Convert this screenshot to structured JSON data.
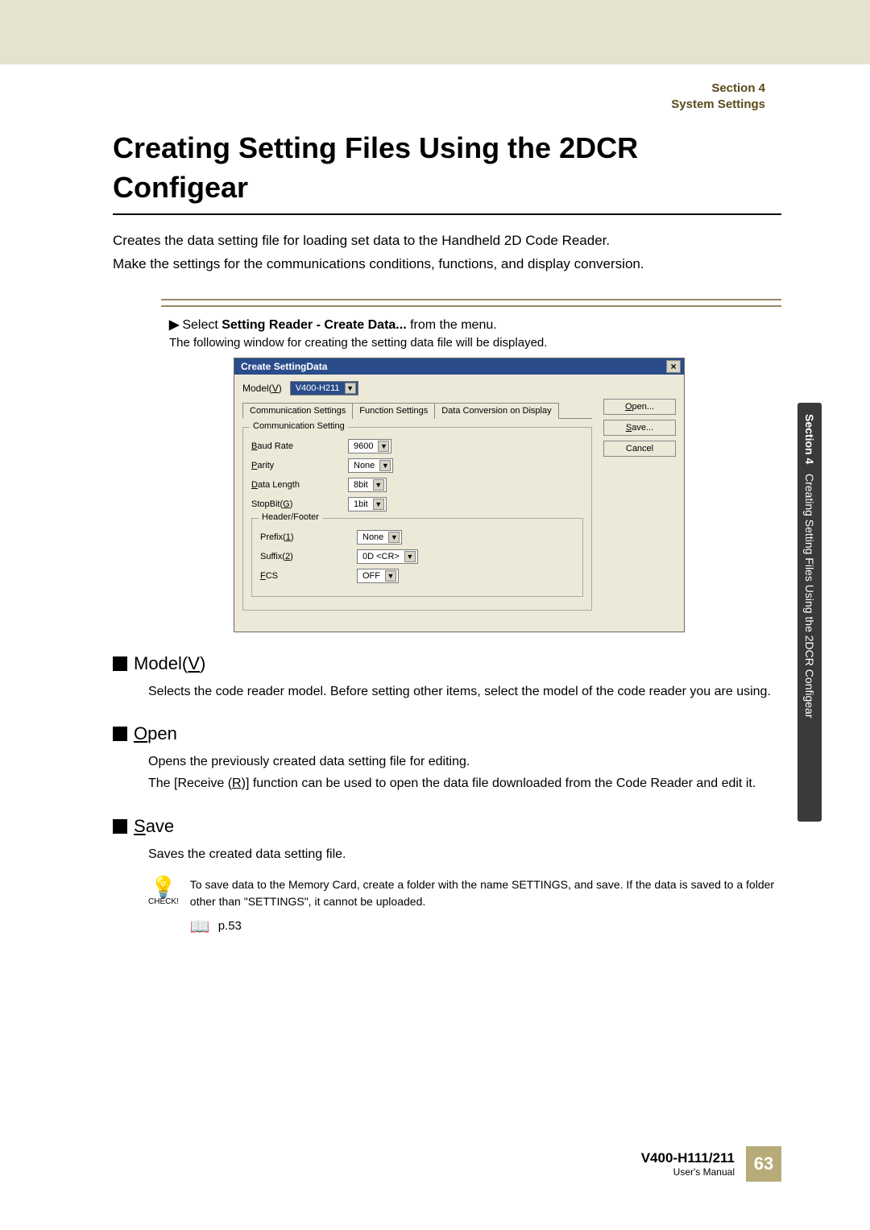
{
  "header": {
    "section_label": "Section 4",
    "section_title": "System Settings"
  },
  "title": "Creating Setting Files Using the 2DCR Configear",
  "intro": {
    "line1": "Creates the data setting file for loading set data to the Handheld 2D Code Reader.",
    "line2": "Make the settings for the communications conditions, functions, and display conversion."
  },
  "step": {
    "arrow": "▶",
    "prefix": "Select ",
    "bold": "Setting Reader - Create Data...",
    "suffix": " from the menu.",
    "sub": "The following window for creating the setting data file will be displayed."
  },
  "dialog": {
    "title": "Create SettingData",
    "close": "×",
    "model_label": "Model(V)",
    "model_value": "V400-H211",
    "tabs": {
      "t1": "Communication Settings",
      "t2": "Function Settings",
      "t3": "Data Conversion on Display"
    },
    "group1_title": "Communication Setting",
    "baud_label": "Baud Rate",
    "baud_value": "9600",
    "parity_label": "Parity",
    "parity_value": "None",
    "data_label": "Data Length",
    "data_value": "8bit",
    "stop_label": "StopBit(G)",
    "stop_value": "1bit",
    "group2_title": "Header/Footer",
    "prefix_label": "Prefix(1)",
    "prefix_value": "None",
    "suffix_label": "Suffix(2)",
    "suffix_value": "0D <CR>",
    "fcs_label": "FCS",
    "fcs_value": "OFF",
    "btn_open": "Open...",
    "btn_save": "Save...",
    "btn_cancel": "Cancel"
  },
  "sections": {
    "model": {
      "heading_pre": "Model(",
      "heading_u": "V",
      "heading_post": ")",
      "body": "Selects the code reader model. Before setting other items, select the model of the code reader you are using."
    },
    "open": {
      "heading_u": "O",
      "heading_post": "pen",
      "l1": "Opens the previously created data setting file for editing.",
      "l2_pre": "The [Receive (",
      "l2_u": "R",
      "l2_post": ")] function can be used to open the data file downloaded from the Code Reader and edit it."
    },
    "save": {
      "heading_u": "S",
      "heading_post": "ave",
      "body": "Saves the created data setting file.",
      "check_label": "CHECK!",
      "check_text": "To save data to the Memory Card, create a folder with the name SETTINGS, and save. If the data is saved to a folder other than \"SETTINGS\", it cannot be uploaded.",
      "ref": "p.53"
    }
  },
  "side_tab": {
    "sec": "Section 4",
    "title": "Creating Setting Files Using the 2DCR Configear"
  },
  "footer": {
    "model": "V400-H111/211",
    "manual": "User's Manual",
    "page": "63"
  }
}
